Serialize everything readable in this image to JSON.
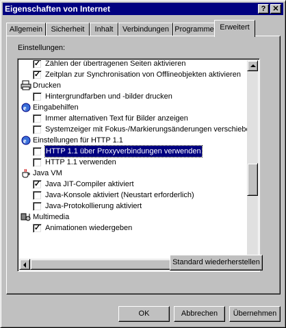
{
  "window": {
    "title": "Eigenschaften von Internet",
    "help_label": "?",
    "close_label": "✕"
  },
  "tabs": [
    {
      "label": "Allgemein"
    },
    {
      "label": "Sicherheit"
    },
    {
      "label": "Inhalt"
    },
    {
      "label": "Verbindungen"
    },
    {
      "label": "Programme"
    },
    {
      "label": "Erweitert"
    }
  ],
  "active_tab": "Erweitert",
  "settings": {
    "label": "Einstellungen:",
    "items": [
      {
        "type": "checkbox",
        "checked": true,
        "label": "Zählen der übertragenen Seiten aktivieren"
      },
      {
        "type": "checkbox",
        "checked": true,
        "label": "Zeitplan zur Synchronisation von Offlineobjekten aktivieren"
      },
      {
        "type": "group",
        "icon": "printer-icon",
        "label": "Drucken"
      },
      {
        "type": "checkbox",
        "checked": false,
        "label": "Hintergrundfarben und -bilder drucken"
      },
      {
        "type": "group",
        "icon": "ie-globe-icon",
        "label": "Eingabehilfen"
      },
      {
        "type": "checkbox",
        "checked": false,
        "label": "Immer alternativen Text für Bilder anzeigen"
      },
      {
        "type": "checkbox",
        "checked": false,
        "label": "Systemzeiger mit Fokus-/Markierungsänderungen verschieben"
      },
      {
        "type": "group",
        "icon": "ie-globe-icon",
        "label": "Einstellungen für HTTP 1.1"
      },
      {
        "type": "checkbox",
        "checked": false,
        "label": "HTTP 1.1 über Proxyverbindungen verwenden",
        "selected": true
      },
      {
        "type": "checkbox",
        "checked": false,
        "label": "HTTP 1.1 verwenden"
      },
      {
        "type": "group",
        "icon": "java-cup-icon",
        "label": "Java VM"
      },
      {
        "type": "checkbox",
        "checked": true,
        "label": "Java JIT-Compiler aktiviert"
      },
      {
        "type": "checkbox",
        "checked": false,
        "label": "Java-Konsole aktiviert (Neustart erforderlich)"
      },
      {
        "type": "checkbox",
        "checked": false,
        "label": "Java-Protokollierung aktiviert"
      },
      {
        "type": "group",
        "icon": "multimedia-icon",
        "label": "Multimedia"
      },
      {
        "type": "checkbox",
        "checked": true,
        "label": "Animationen wiedergeben"
      }
    ],
    "restore_button": "Standard wiederherstellen"
  },
  "footer": {
    "ok": "OK",
    "cancel": "Abbrechen",
    "apply": "Übernehmen"
  },
  "colors": {
    "face": "#c0c0c0",
    "titlebar": "#000080",
    "selection": "#000080"
  }
}
